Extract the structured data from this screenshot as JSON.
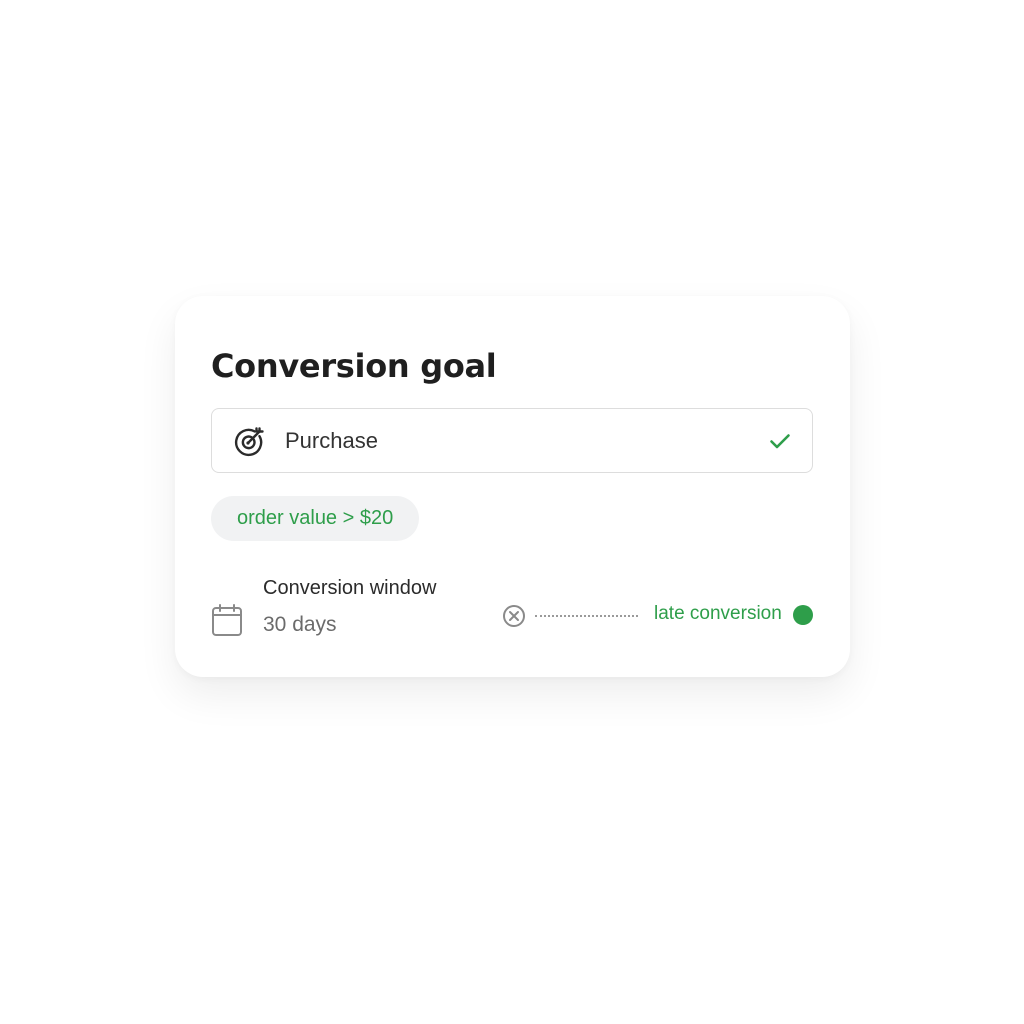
{
  "card": {
    "title": "Conversion goal",
    "goal": {
      "label": "Purchase",
      "icon": "target-icon",
      "status_icon": "check-icon",
      "selected": true
    },
    "filter_chip": {
      "label": "order value > $20"
    },
    "conversion_window": {
      "label": "Conversion window",
      "value": "30 days",
      "icon": "calendar-icon"
    },
    "late_conversion": {
      "label": "late conversion",
      "remove_icon": "x-circle-icon",
      "status_dot_color": "#2e9e4a"
    }
  },
  "colors": {
    "accent_green": "#2e9e4a",
    "title_text": "#1f1f1f",
    "muted_text": "#6b6b6b",
    "chip_background": "#f1f2f3",
    "border": "#dddddd"
  }
}
